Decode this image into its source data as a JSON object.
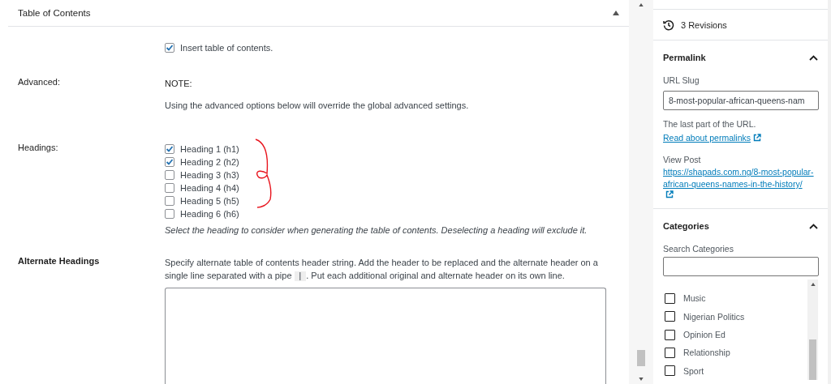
{
  "panel": {
    "title": "Table of Contents",
    "expanded": true
  },
  "insert_toc": {
    "label": "Insert table of contents.",
    "checked": true
  },
  "advanced": {
    "label": "Advanced:",
    "note_title": "NOTE:",
    "note": "Using the advanced options below will override the global advanced settings."
  },
  "headings": {
    "label": "Headings:",
    "options": [
      {
        "label": "Heading 1 (h1)",
        "checked": true
      },
      {
        "label": "Heading 2 (h2)",
        "checked": true
      },
      {
        "label": "Heading 3 (h3)",
        "checked": false
      },
      {
        "label": "Heading 4 (h4)",
        "checked": false
      },
      {
        "label": "Heading 5 (h5)",
        "checked": false
      },
      {
        "label": "Heading 6 (h6)",
        "checked": false
      }
    ],
    "hint": "Select the heading to consider when generating the table of contents. Deselecting a heading will exclude it."
  },
  "alternate_headings": {
    "label": "Alternate Headings",
    "description_before": "Specify alternate table of contents header string. Add the header to be replaced and the alternate header on a single line separated with a pipe",
    "pipe": "|",
    "description_after": ". Put each additional original and alternate header on its own line."
  },
  "sidebar": {
    "revisions": "3 Revisions",
    "permalink": {
      "title": "Permalink",
      "expanded": true,
      "slug_label": "URL Slug",
      "slug_value": "8-most-popular-african-queens-nam",
      "help": "The last part of the URL.",
      "help_link": "Read about permalinks",
      "view_label": "View Post",
      "view_link": "https://shapads.com.ng/8-most-popular-african-queens-names-in-the-history/"
    },
    "categories": {
      "title": "Categories",
      "expanded": true,
      "search_label": "Search Categories",
      "items": [
        {
          "label": "Music",
          "checked": false
        },
        {
          "label": "Nigerian Politics",
          "checked": false
        },
        {
          "label": "Opinion Ed",
          "checked": false
        },
        {
          "label": "Relationship",
          "checked": false
        },
        {
          "label": "Sport",
          "checked": false
        }
      ]
    }
  }
}
